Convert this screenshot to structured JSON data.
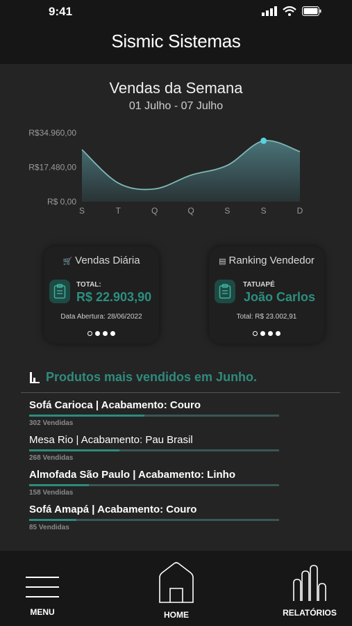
{
  "status": {
    "time": "9:41"
  },
  "app": {
    "title": "Sismic Sistemas"
  },
  "chart": {
    "title": "Vendas da Semana",
    "subtitle": "01 Julho - 07 Julho"
  },
  "chart_data": {
    "type": "area",
    "title": "Vendas da Semana",
    "subtitle": "01 Julho - 07 Julho",
    "categories": [
      "S",
      "T",
      "Q",
      "Q",
      "S",
      "S",
      "D"
    ],
    "values": [
      26500,
      9500,
      6500,
      13500,
      18500,
      31000,
      25500
    ],
    "highlight_index": 5,
    "y_ticks": [
      "R$34.960,00",
      "R$17.480,00",
      "R$ 0,00"
    ],
    "y_tick_values": [
      34960,
      17480,
      0
    ],
    "ylim": [
      0,
      40000
    ],
    "grid": false,
    "colors": {
      "line": "#7fb8b4",
      "highlight": "#5ad0e0"
    }
  },
  "cards": {
    "daily": {
      "title": "Vendas Diária",
      "icon": "cart-icon",
      "label": "TOTAL:",
      "value": "R$ 22.903,90",
      "footer": "Data Abertura: 28/06/2022"
    },
    "ranking": {
      "title": "Ranking Vendedor",
      "icon": "ranking-icon",
      "label": "TATUAPÉ",
      "value": "João Carlos",
      "footer": "Total: R$ 23.002,91"
    }
  },
  "products": {
    "title": "Produtos mais vendidos em Junho.",
    "items": [
      {
        "name": "Sofá Carioca | Acabamento: Couro",
        "count": "302 Vendidas",
        "fraction": 0.46
      },
      {
        "name": "Mesa Rio | Acabamento: Pau Brasil",
        "count": "268 Vendidas",
        "fraction": 0.36
      },
      {
        "name": "Almofada São Paulo | Acabamento: Linho",
        "count": "158 Vendidas",
        "fraction": 0.24
      },
      {
        "name": "Sofá Amapá | Acabamento: Couro",
        "count": "85 Vendidas",
        "fraction": 0.19
      }
    ]
  },
  "tabs": {
    "menu": "MENU",
    "home": "HOME",
    "reports": "RELATÓRIOS"
  },
  "colors": {
    "accent": "#2f8b7d",
    "background": "#242424",
    "bar_track": "#3a5755"
  }
}
